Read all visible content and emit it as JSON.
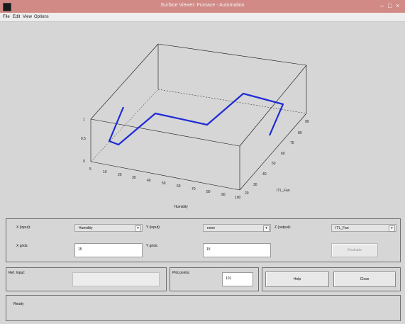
{
  "window": {
    "title": "Surface Viewer: Furnace - Automation",
    "controls": [
      "–",
      "□",
      "×"
    ]
  },
  "menu": [
    "File",
    "Edit",
    "View",
    "Options"
  ],
  "plot": {
    "x_ticks": [
      "5",
      "10",
      "20",
      "30",
      "40",
      "50",
      "60",
      "70",
      "80",
      "90",
      "100"
    ],
    "y_ticks": [
      "20",
      "30",
      "40",
      "50",
      "60",
      "70",
      "80",
      "90"
    ],
    "z_ticks": [
      "1",
      "0.5",
      "0"
    ],
    "x_title": "Humidity",
    "y_title": "ITL_Fan",
    "line_color": "#1f2bd6"
  },
  "controls": {
    "x_label": "X (input):",
    "x_value": "Humidity",
    "y_label": "Y (input):",
    "y_value": "none",
    "z_label": "Z (output):",
    "z_value": "ITL_Fan",
    "xgrids_label": "X grids:",
    "xgrids_value": "15",
    "ygrids_label": "Y grids:",
    "ygrids_value": "15",
    "evaluate_label": "Evaluate",
    "refinput_label": "Ref. Input:",
    "refinput_value": "",
    "plotpoints_label": "Plot points:",
    "plotpoints_value": "101",
    "help_label": "Help",
    "close_label": "Close",
    "status": "Ready"
  }
}
